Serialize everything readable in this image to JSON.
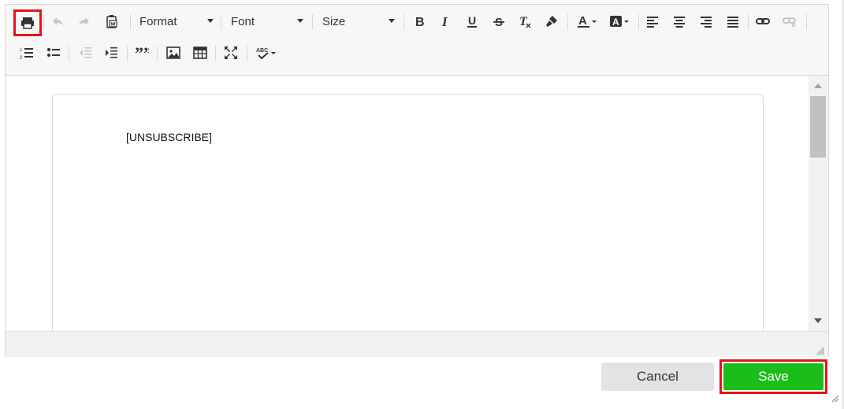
{
  "toolbar": {
    "format_label": "Format",
    "font_label": "Font",
    "size_label": "Size"
  },
  "document": {
    "text": "[UNSUBSCRIBE]"
  },
  "footer": {
    "cancel_label": "Cancel",
    "save_label": "Save"
  },
  "colors": {
    "highlight": "#e3141c",
    "save_green": "#1bbd1b"
  }
}
